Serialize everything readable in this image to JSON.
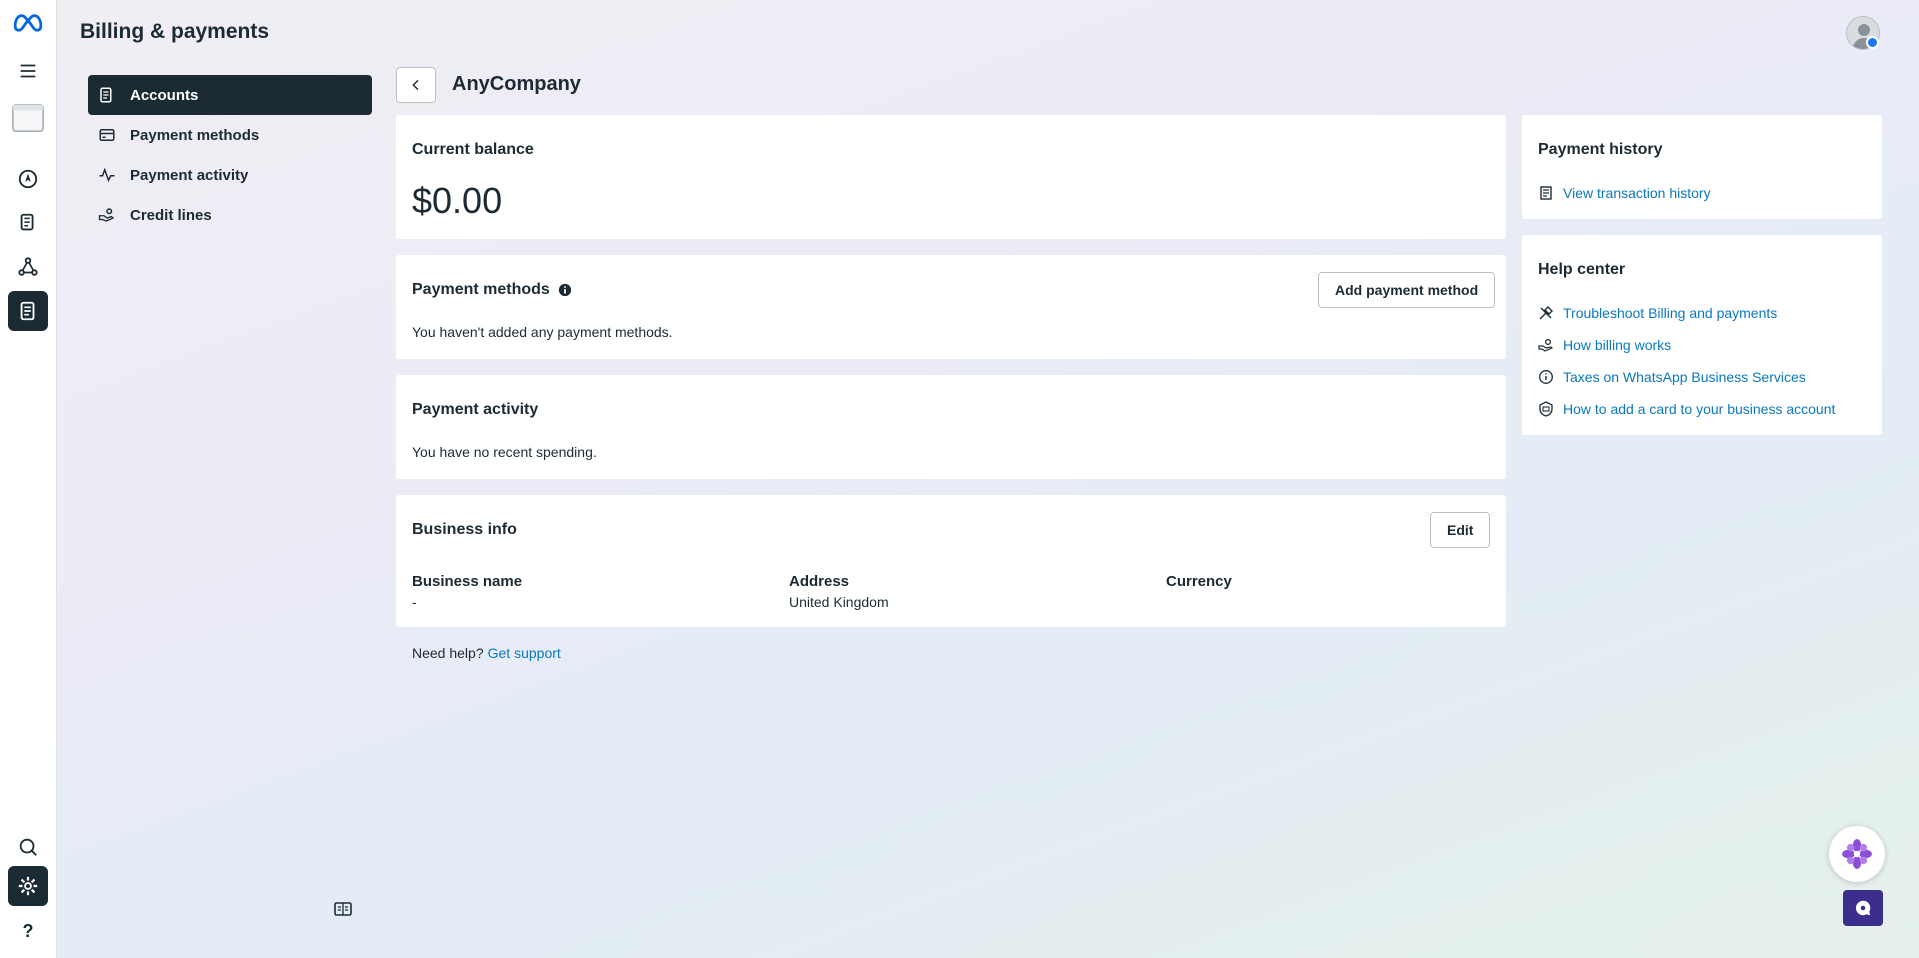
{
  "header": {
    "title": "Billing & payments"
  },
  "rail": {
    "icons": [
      "meta-logo-icon",
      "menu-icon",
      "browser-window-icon",
      "compass-icon",
      "documents-icon",
      "network-icon",
      "billing-icon",
      "search-icon",
      "settings-icon",
      "help-icon"
    ],
    "help_label": "?"
  },
  "subnav": {
    "items": [
      {
        "label": "Accounts",
        "icon": "accounts-icon",
        "active": true
      },
      {
        "label": "Payment methods",
        "icon": "card-icon"
      },
      {
        "label": "Payment activity",
        "icon": "activity-icon"
      },
      {
        "label": "Credit lines",
        "icon": "hand-coins-icon"
      }
    ]
  },
  "account": {
    "name": "AnyCompany"
  },
  "balance": {
    "title": "Current balance",
    "amount": "$0.00"
  },
  "payment_methods": {
    "title": "Payment methods",
    "add_button": "Add payment method",
    "empty": "You haven't added any payment methods."
  },
  "payment_activity": {
    "title": "Payment activity",
    "empty": "You have no recent spending."
  },
  "business_info": {
    "title": "Business info",
    "edit_button": "Edit",
    "fields": [
      {
        "label": "Business name",
        "value": "-"
      },
      {
        "label": "Address",
        "value": "United Kingdom"
      },
      {
        "label": "Currency",
        "value": ""
      }
    ]
  },
  "footer": {
    "need_help": "Need help?",
    "support_link": "Get support"
  },
  "payment_history": {
    "title": "Payment history",
    "link": "View transaction history"
  },
  "help_center": {
    "title": "Help center",
    "links": [
      "Troubleshoot Billing and payments",
      "How billing works",
      "Taxes on WhatsApp Business Services",
      "How to add a card to your business account"
    ]
  },
  "colors": {
    "accent": "#0a78be",
    "dark": "#1c2b33",
    "chat": "#3b2e8c"
  }
}
